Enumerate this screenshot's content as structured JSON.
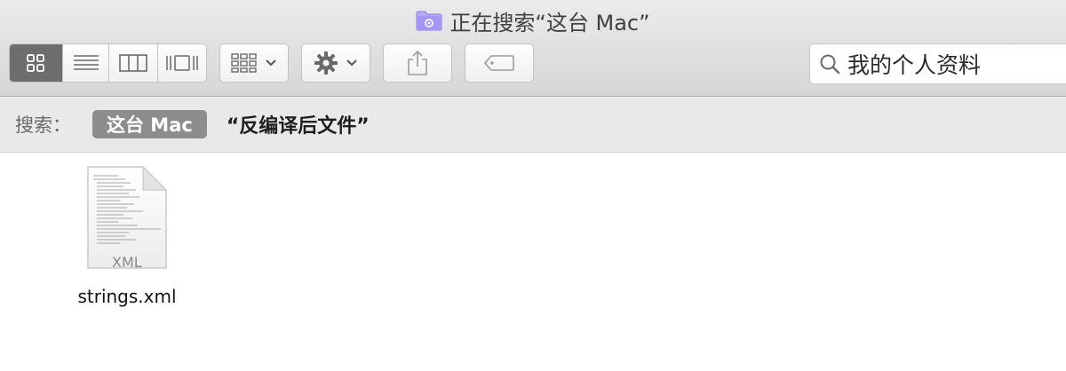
{
  "window": {
    "title": "正在搜索“这台 Mac”",
    "title_icon": "smart-folder-icon"
  },
  "toolbar": {
    "view_modes": [
      {
        "name": "icon-view",
        "icon": "grid-icon",
        "active": true
      },
      {
        "name": "list-view",
        "icon": "list-icon",
        "active": false
      },
      {
        "name": "column-view",
        "icon": "columns-icon",
        "active": false
      },
      {
        "name": "gallery-view",
        "icon": "coverflow-icon",
        "active": false
      }
    ],
    "group_button": {
      "icon": "group-grid-icon",
      "dropdown": true
    },
    "action_button": {
      "icon": "gear-icon",
      "dropdown": true
    },
    "share_button": {
      "icon": "share-icon"
    },
    "tags_button": {
      "icon": "tag-icon"
    }
  },
  "search": {
    "value": "我的个人资料",
    "icon": "search-icon"
  },
  "scope_bar": {
    "label": "搜索：",
    "scope": "这台 Mac",
    "query": "“反编译后文件”"
  },
  "files": [
    {
      "name": "strings.xml",
      "type_label": "XML",
      "icon": "xml-document-icon"
    }
  ],
  "colors": {
    "active_segment": "#6d6d6d",
    "scope_token": "#8d8d8d",
    "folder_icon": "#9d8ff2"
  }
}
